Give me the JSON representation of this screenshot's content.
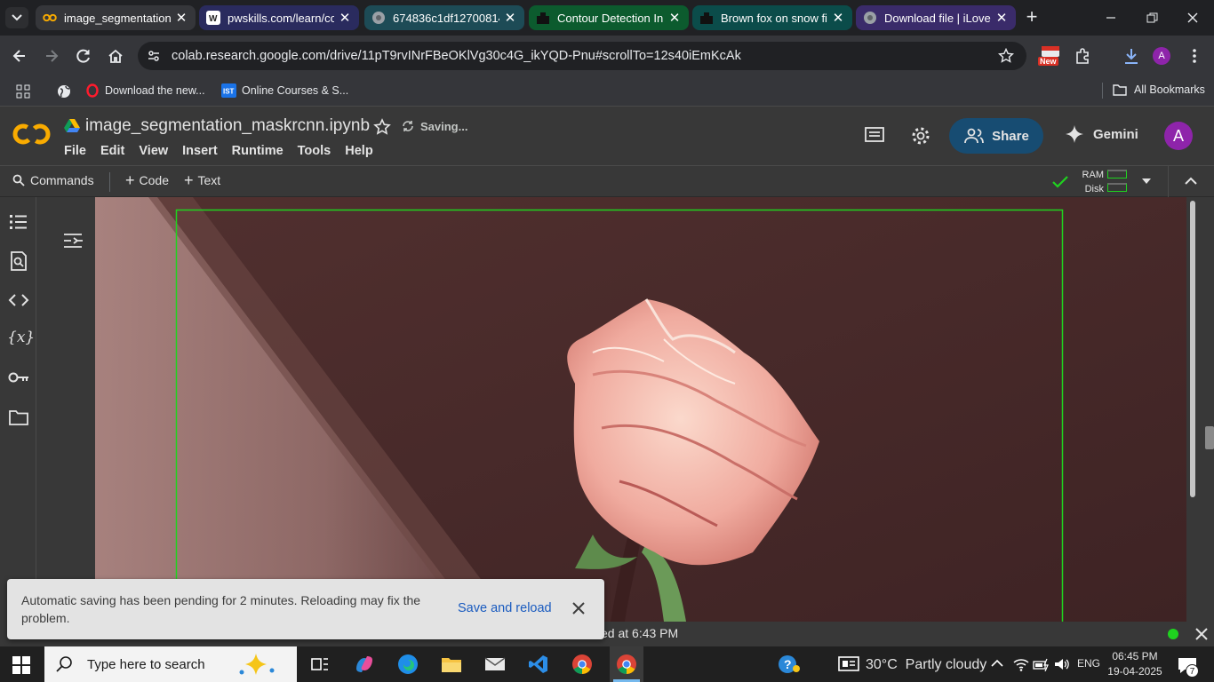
{
  "browser": {
    "tabs": [
      {
        "title": "image_segmentation_",
        "active": true
      },
      {
        "title": "pwskills.com/learn/co",
        "active": false
      },
      {
        "title": "674836c1df12700814",
        "active": false
      },
      {
        "title": "Contour Detection In",
        "active": false
      },
      {
        "title": "Brown fox on snow fi",
        "active": false
      },
      {
        "title": "Download file | iLoveI",
        "active": false
      }
    ],
    "url": "colab.research.google.com/drive/11pT9rvINrFBeOKlVg30c4G_ikYQD-Pnu#scrollTo=12s40iEmKcAk",
    "new_badge": "New",
    "profile_initial": "A",
    "bookmarks": [
      {
        "label": "Download the new..."
      },
      {
        "label": "Online Courses & S..."
      }
    ],
    "all_bookmarks": "All Bookmarks"
  },
  "colab": {
    "notebook_name": "image_segmentation_maskrcnn.ipynb",
    "saving_status": "Saving...",
    "menu": [
      "File",
      "Edit",
      "View",
      "Insert",
      "Runtime",
      "Tools",
      "Help"
    ],
    "share_label": "Share",
    "gemini_label": "Gemini",
    "avatar_initial": "A",
    "commands_label": "Commands",
    "add_code_label": "Code",
    "add_text_label": "Text",
    "ram_label": "RAM",
    "disk_label": "Disk",
    "status_text": "ed at 6:43 PM"
  },
  "toast": {
    "message": "Automatic saving has been pending for 2 minutes. Reloading may fix the problem.",
    "action_label": "Save and reload"
  },
  "taskbar": {
    "search_placeholder": "Type here to search",
    "weather": "30°C  Partly cloudy",
    "language": "ENG",
    "time": "06:45 PM",
    "date": "19-04-2025",
    "notifications_count": "7"
  },
  "colors": {
    "accent_green": "#1fd31f",
    "share_button": "#174c72",
    "gemini_avatar": "#8e24aa",
    "output_background": "#4c2b2c"
  }
}
